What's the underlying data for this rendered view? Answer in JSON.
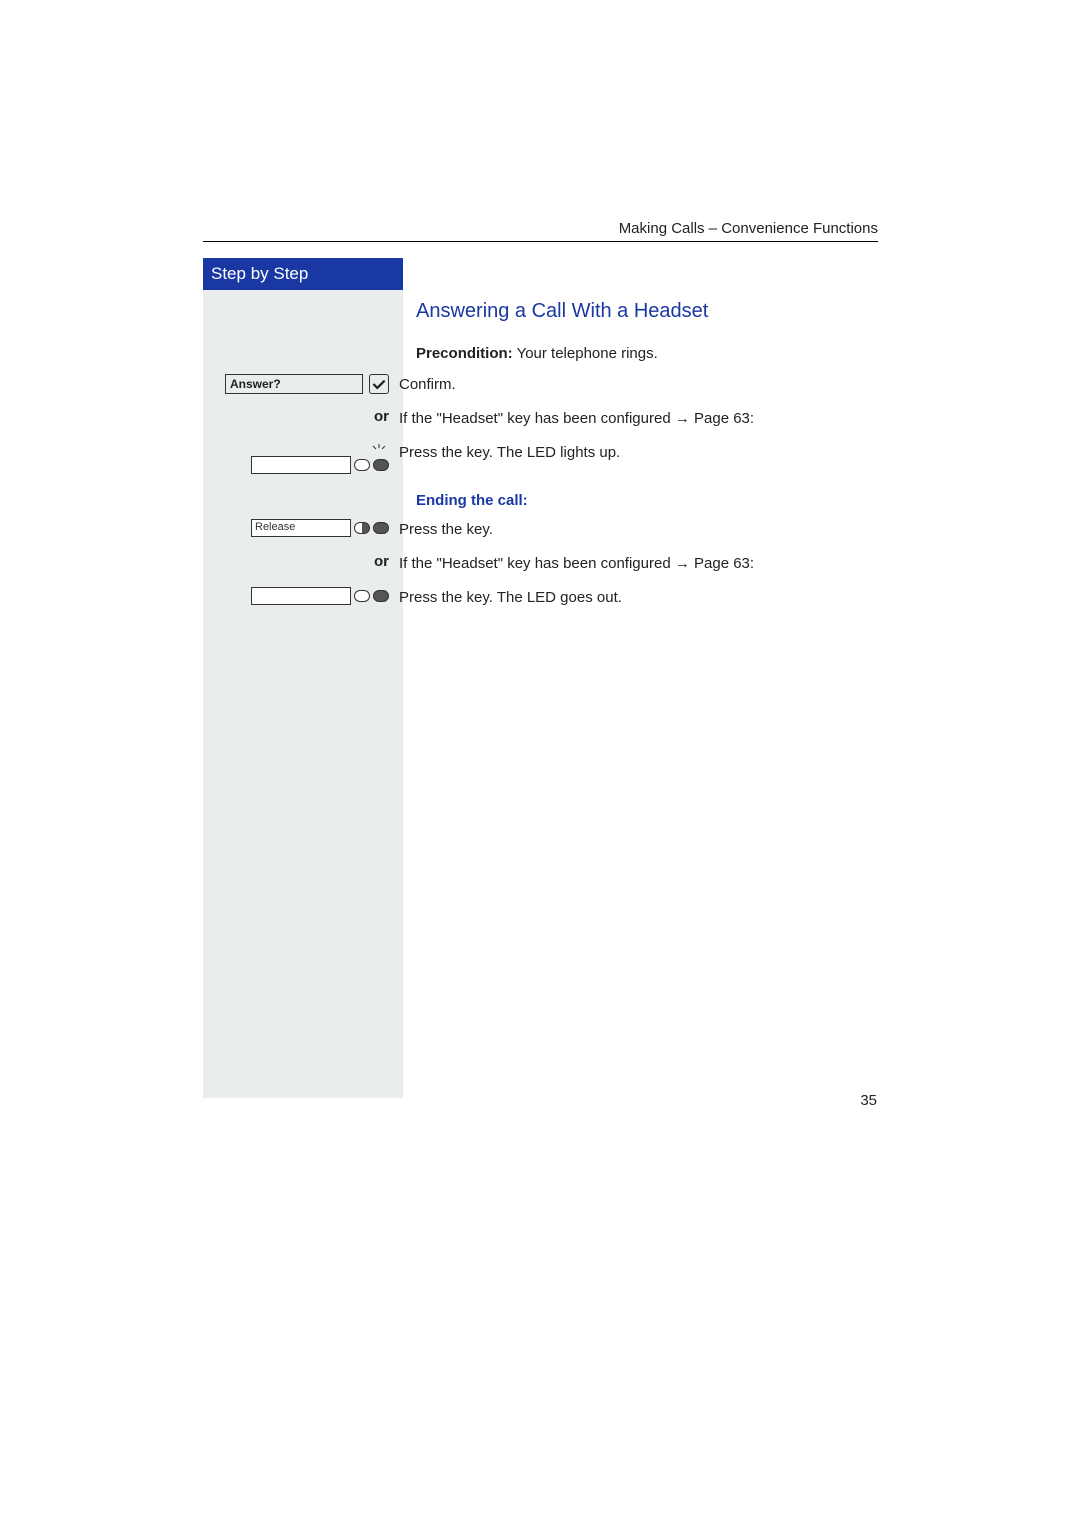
{
  "header": {
    "running_title": "Making Calls – Convenience Functions"
  },
  "sidebar": {
    "title": "Step by Step"
  },
  "section": {
    "title": "Answering a Call With a Headset",
    "precondition_label": "Precondition:",
    "precondition_text": " Your telephone rings.",
    "answer_display": "Answer?",
    "confirm": "Confirm.",
    "or": "or",
    "headset_configured": "If the \"Headset\" key has been configured ",
    "page_ref": "Page 63:",
    "press_led_on": "Press the key. The LED lights up.",
    "ending_heading": "Ending the call:",
    "release_label": "Release",
    "press_key": "Press the key.",
    "press_led_off": "Press the key. The LED goes out."
  },
  "page_number": "35"
}
